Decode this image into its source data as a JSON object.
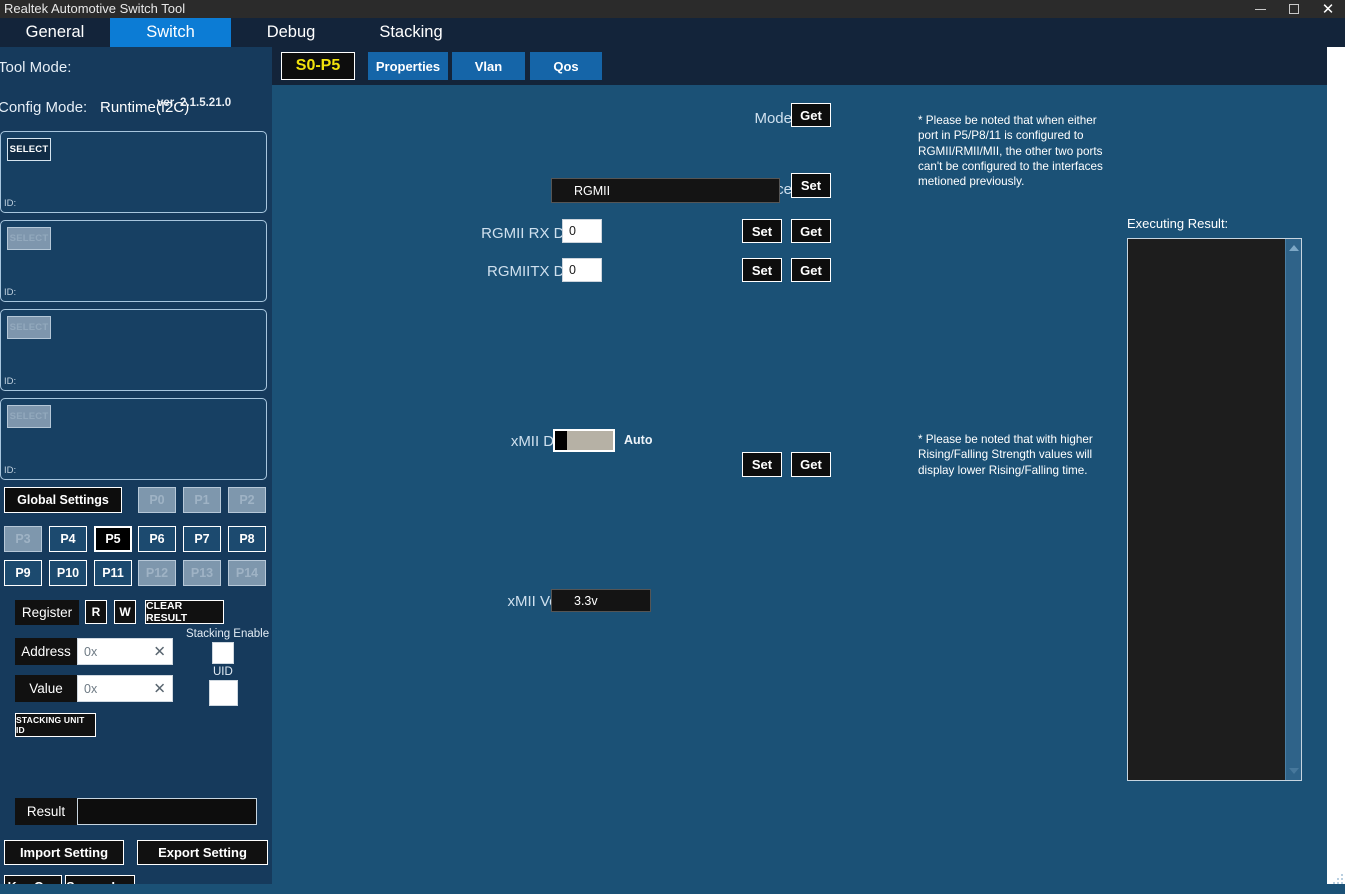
{
  "window": {
    "title": "Realtek Automotive Switch Tool",
    "minimize_label": "minimize",
    "maximize_label": "maximize",
    "close_label": "✕"
  },
  "tabs": [
    {
      "label": "General",
      "active": false
    },
    {
      "label": "Switch",
      "active": true
    },
    {
      "label": "Debug",
      "active": false
    },
    {
      "label": "Stacking",
      "active": false
    }
  ],
  "sidebar": {
    "tool_mode_label": "Tool Mode:",
    "tool_mode_value": "",
    "version": "ver. 2.1.5.21.0",
    "config_mode_label": "Config Mode:",
    "config_mode_value": "Runtime(I2C)",
    "select_panels": [
      {
        "button_label": "SELECT",
        "id_label": "ID:",
        "id_value": "",
        "enabled": true
      },
      {
        "button_label": "SELECT",
        "id_label": "ID:",
        "id_value": "",
        "enabled": false
      },
      {
        "button_label": "SELECT",
        "id_label": "ID:",
        "id_value": "",
        "enabled": false
      },
      {
        "button_label": "SELECT",
        "id_label": "ID:",
        "id_value": "",
        "enabled": false
      }
    ],
    "global_settings_label": "Global Settings",
    "ports": [
      {
        "label": "P0",
        "state": "disabled"
      },
      {
        "label": "P1",
        "state": "disabled"
      },
      {
        "label": "P2",
        "state": "disabled"
      },
      {
        "label": "P3",
        "state": "disabled"
      },
      {
        "label": "P4",
        "state": "enabled"
      },
      {
        "label": "P5",
        "state": "active"
      },
      {
        "label": "P6",
        "state": "enabled"
      },
      {
        "label": "P7",
        "state": "enabled"
      },
      {
        "label": "P8",
        "state": "enabled"
      },
      {
        "label": "P9",
        "state": "enabled"
      },
      {
        "label": "P10",
        "state": "enabled"
      },
      {
        "label": "P11",
        "state": "enabled"
      },
      {
        "label": "P12",
        "state": "disabled"
      },
      {
        "label": "P13",
        "state": "disabled"
      },
      {
        "label": "P14",
        "state": "disabled"
      }
    ],
    "register": {
      "register_label": "Register",
      "read_label": "R",
      "write_label": "W",
      "clear_result_label": "CLEAR RESULT",
      "address_label": "Address",
      "address_value": "",
      "address_placeholder": "0x",
      "value_label": "Value",
      "value_value": "",
      "value_placeholder": "0x",
      "clear_icon": "✕",
      "stacking_enable_label": "Stacking Enable",
      "stacking_enable_checked": false,
      "uid_label": "UID",
      "uid_value": "",
      "stacking_unit_id_label": "STACKING  UNIT ID"
    },
    "result_label": "Result",
    "result_value": "",
    "import_setting_label": "Import Setting",
    "export_setting_label": "Export Setting",
    "key_gen_label": "Key Gen",
    "secure_img_label": "Secure Img"
  },
  "subtabs": [
    {
      "label": "S0-P5",
      "style": "selected-unit"
    },
    {
      "label": "Properties",
      "style": "blue"
    },
    {
      "label": "Vlan",
      "style": "blue"
    },
    {
      "label": "Qos",
      "style": "blue"
    }
  ],
  "form": {
    "mode": {
      "label": "Mode",
      "value": "",
      "get_label": "Get"
    },
    "interface": {
      "label": "Interface",
      "value": "RGMII",
      "set_label": "Set"
    },
    "rgmii_rx_delay": {
      "label": "RGMII RX Delay",
      "value": "0",
      "set_label": "Set",
      "get_label": "Get"
    },
    "rgmii_tx_delay": {
      "label": "RGMIITX Delay",
      "value": "0",
      "set_label": "Set",
      "get_label": "Get"
    },
    "xmii_driving": {
      "label": "xMII Driving",
      "toggle_state": "off",
      "toggle_text": "Auto",
      "set_label": "Set",
      "get_label": "Get"
    },
    "xmii_voltage": {
      "label": "xMII Voltage",
      "value": "3.3v"
    }
  },
  "notes": {
    "interface_note": "* Please be noted that when either port in P5/P8/11 is configured to RGMII/RMII/MII, the other two ports can't be configured to the interfaces metioned previously.",
    "driving_note": "* Please be noted that with higher Rising/Falling Strength values will display lower Rising/Falling time."
  },
  "executing_result": {
    "title": "Executing Result:",
    "content": "",
    "scroll_up_icon": "scroll-up-arrow",
    "scroll_down_icon": "scroll-down-arrow"
  },
  "colors": {
    "titlebar": "#2b2b2b",
    "tabstrip": "#13243a",
    "active_tab": "#0c7cd5",
    "sidebar": "#163a5c",
    "content": "#1b5176",
    "black_button": "#0d0d0d",
    "unit_tab_text": "#f2e20c"
  }
}
